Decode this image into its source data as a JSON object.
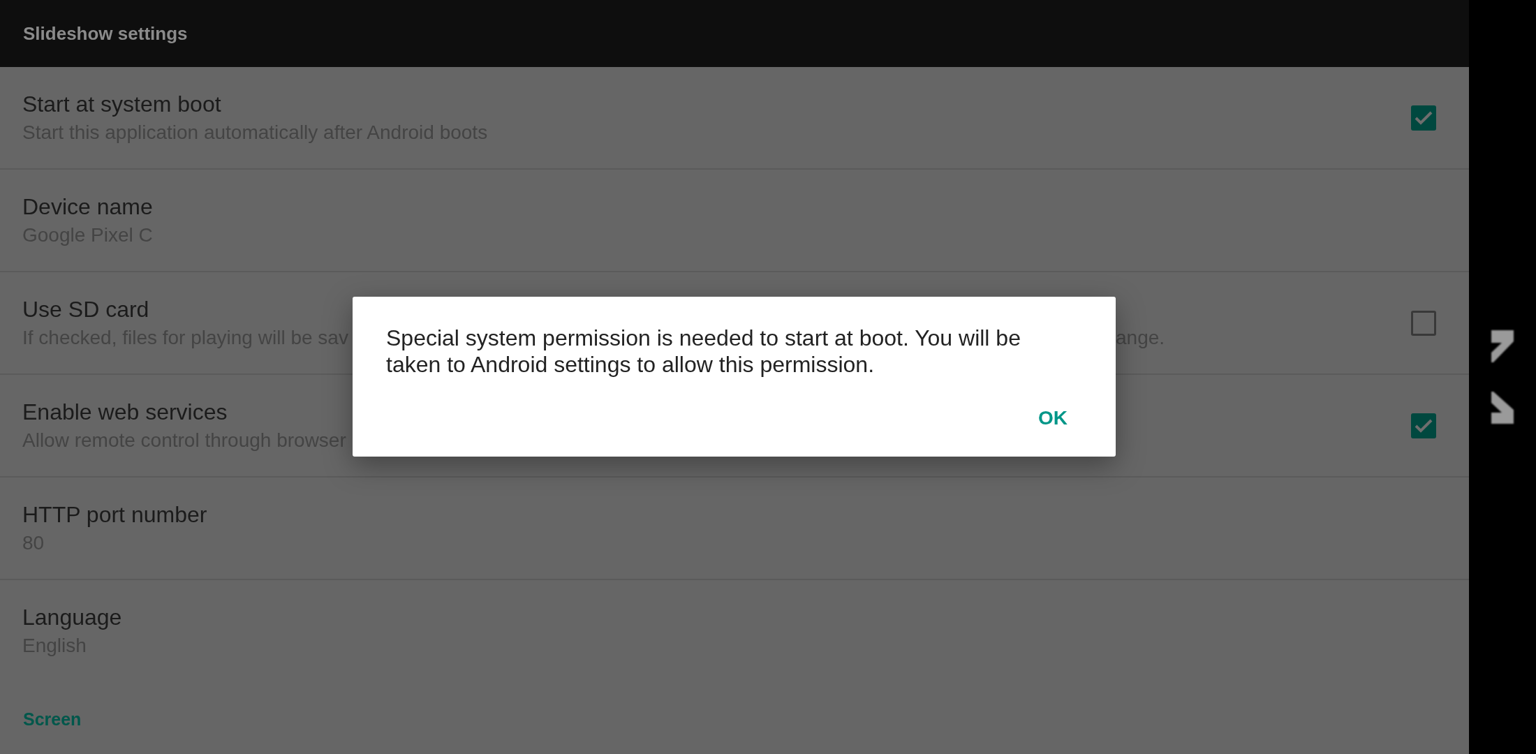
{
  "app_bar": {
    "title": "Slideshow settings"
  },
  "preferences": [
    {
      "kind": "checkbox",
      "title": "Start at system boot",
      "summary": "Start this application automatically after Android boots",
      "checked": true
    },
    {
      "kind": "text",
      "title": "Device name",
      "summary": "Google Pixel C"
    },
    {
      "kind": "checkbox",
      "title": "Use SD card",
      "summary": "If checked, files for playing will be sav",
      "summary_right_part": "ange.",
      "checked": false
    },
    {
      "kind": "checkbox",
      "title": "Enable web services",
      "summary": "Allow remote control through browser",
      "checked": true
    },
    {
      "kind": "text",
      "title": "HTTP port number",
      "summary": "80"
    },
    {
      "kind": "text",
      "title": "Language",
      "summary": "English"
    }
  ],
  "category": {
    "title": "Screen"
  },
  "dialog": {
    "message": "Special system permission is needed to start at boot. You will be taken to Android settings to allow this permission.",
    "buttons": [
      "OK"
    ]
  }
}
